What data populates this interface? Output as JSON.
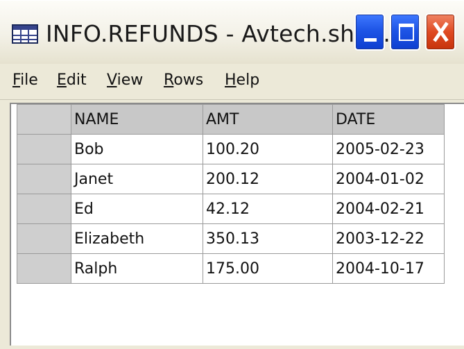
{
  "window": {
    "title": "INFO.REFUNDS - Avtech.sho...",
    "icon": "table-icon",
    "controls": {
      "minimize": "minimize-icon",
      "maximize": "maximize-icon",
      "close": "close-icon"
    }
  },
  "menu": {
    "items": [
      {
        "accel": "F",
        "rest": "ile"
      },
      {
        "accel": "E",
        "rest": "dit"
      },
      {
        "accel": "V",
        "rest": "iew"
      },
      {
        "accel": "R",
        "rest": "ows"
      },
      {
        "accel": "H",
        "rest": "elp"
      }
    ]
  },
  "grid": {
    "columns": [
      "NAME",
      "AMT",
      "DATE"
    ],
    "rows": [
      [
        "Bob",
        "100.20",
        "2005-02-23"
      ],
      [
        "Janet",
        "200.12",
        "2004-01-02"
      ],
      [
        "Ed",
        "42.12",
        "2004-02-21"
      ],
      [
        "Elizabeth",
        "350.13",
        "2003-12-22"
      ],
      [
        "Ralph",
        "175.00",
        "2004-10-17"
      ]
    ]
  },
  "colors": {
    "grid_header": "#c8c8c8",
    "grid_border": "#9a9a9a",
    "window_bg": "#ece9d8"
  }
}
